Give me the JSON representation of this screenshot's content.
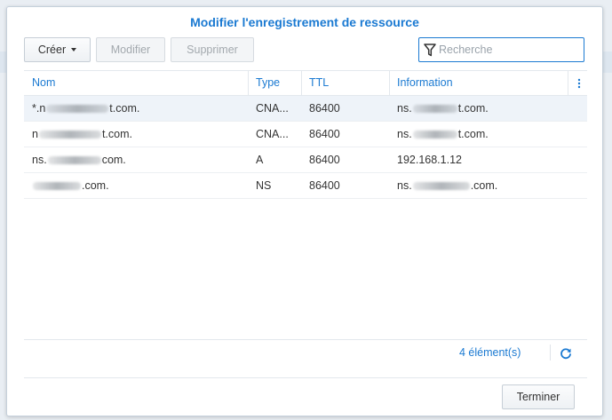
{
  "dialog": {
    "title": "Modifier l'enregistrement de ressource"
  },
  "toolbar": {
    "create_label": "Créer",
    "edit_label": "Modifier",
    "delete_label": "Supprimer"
  },
  "search": {
    "placeholder": "Recherche",
    "value": ""
  },
  "table": {
    "columns": [
      "Nom",
      "Type",
      "TTL",
      "Information"
    ],
    "rows": [
      {
        "name_prefix": "*.n",
        "name_suffix": "t.com.",
        "type": "CNA...",
        "ttl": "86400",
        "info_prefix": "ns.",
        "info_suffix": "t.com."
      },
      {
        "name_prefix": "n",
        "name_suffix": "t.com.",
        "type": "CNA...",
        "ttl": "86400",
        "info_prefix": "ns.",
        "info_suffix": "t.com."
      },
      {
        "name_prefix": "ns.",
        "name_suffix": "com.",
        "type": "A",
        "ttl": "86400",
        "info_prefix": "192.168.1.12",
        "info_suffix": ""
      },
      {
        "name_prefix": "",
        "name_suffix": ".com.",
        "type": "NS",
        "ttl": "86400",
        "info_prefix": "ns.",
        "info_suffix": ".com."
      }
    ]
  },
  "footer": {
    "count_label": "4 élément(s)",
    "finish_label": "Terminer"
  },
  "colors": {
    "accent": "#1b7ad2",
    "selected_row": "#eef3f9"
  },
  "icons": {
    "filter": "filter-icon",
    "refresh": "refresh-icon",
    "caret": "caret-down-icon",
    "column_menu": "column-menu-icon"
  }
}
